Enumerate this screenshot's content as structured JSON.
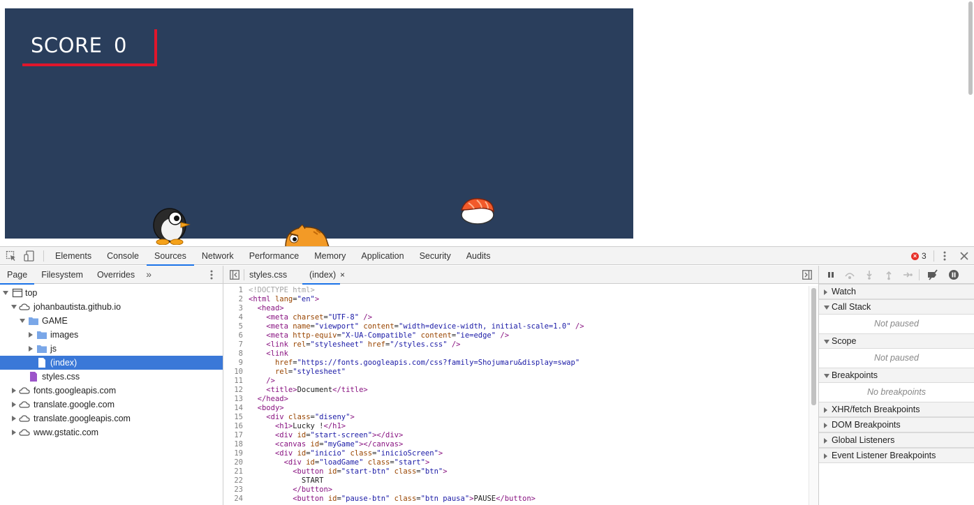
{
  "game": {
    "score_label": "SCORE",
    "score_value": "0",
    "colors": {
      "background": "#2a3e5c",
      "accent": "#e0162b"
    }
  },
  "devtools": {
    "tabs": [
      "Elements",
      "Console",
      "Sources",
      "Network",
      "Performance",
      "Memory",
      "Application",
      "Security",
      "Audits"
    ],
    "active_tab": "Sources",
    "error_count": "3",
    "navigator": {
      "tabs": [
        "Page",
        "Filesystem",
        "Overrides"
      ],
      "more": "»",
      "tree": [
        {
          "label": "top",
          "icon": "frame-icon"
        },
        {
          "label": "johanbautista.github.io",
          "icon": "cloud-icon"
        },
        {
          "label": "GAME",
          "icon": "folder-icon"
        },
        {
          "label": "images",
          "icon": "folder-icon"
        },
        {
          "label": "js",
          "icon": "folder-icon"
        },
        {
          "label": "(index)",
          "icon": "document-icon"
        },
        {
          "label": "styles.css",
          "icon": "css-file-icon"
        },
        {
          "label": "fonts.googleapis.com",
          "icon": "cloud-icon"
        },
        {
          "label": "translate.google.com",
          "icon": "cloud-icon"
        },
        {
          "label": "translate.googleapis.com",
          "icon": "cloud-icon"
        },
        {
          "label": "www.gstatic.com",
          "icon": "cloud-icon"
        }
      ]
    },
    "editor": {
      "tabs": [
        "styles.css",
        "(index)"
      ],
      "active_tab": "(index)",
      "close_glyph": "×",
      "lines": [
        "<!DOCTYPE html>",
        "<html lang=\"en\">",
        "  <head>",
        "    <meta charset=\"UTF-8\" />",
        "    <meta name=\"viewport\" content=\"width=device-width, initial-scale=1.0\" />",
        "    <meta http-equiv=\"X-UA-Compatible\" content=\"ie=edge\" />",
        "    <link rel=\"stylesheet\" href=\"/styles.css\" />",
        "    <link",
        "      href=\"https://fonts.googleapis.com/css?family=Shojumaru&display=swap\"",
        "      rel=\"stylesheet\"",
        "    />",
        "    <title>Document</title>",
        "  </head>",
        "  <body>",
        "    <div class=\"diseny\">",
        "      <h1>Lucky !</h1>",
        "      <div id=\"start-screen\"></div>",
        "      <canvas id=\"myGame\"></canvas>",
        "      <div id=\"inicio\" class=\"inicioScreen\">",
        "        <div id=\"loadGame\" class=\"start\">",
        "          <button id=\"start-btn\" class=\"btn\">",
        "            START",
        "          </button>",
        "          <button id=\"pause-btn\" class=\"btn pausa\">PAUSE</button>"
      ]
    },
    "debugger": {
      "panes": [
        {
          "title": "Watch",
          "expanded": false,
          "body": ""
        },
        {
          "title": "Call Stack",
          "expanded": true,
          "body": "Not paused"
        },
        {
          "title": "Scope",
          "expanded": true,
          "body": "Not paused"
        },
        {
          "title": "Breakpoints",
          "expanded": true,
          "body": "No breakpoints"
        },
        {
          "title": "XHR/fetch Breakpoints",
          "expanded": false,
          "body": ""
        },
        {
          "title": "DOM Breakpoints",
          "expanded": false,
          "body": ""
        },
        {
          "title": "Global Listeners",
          "expanded": false,
          "body": ""
        },
        {
          "title": "Event Listener Breakpoints",
          "expanded": false,
          "body": ""
        }
      ]
    }
  }
}
